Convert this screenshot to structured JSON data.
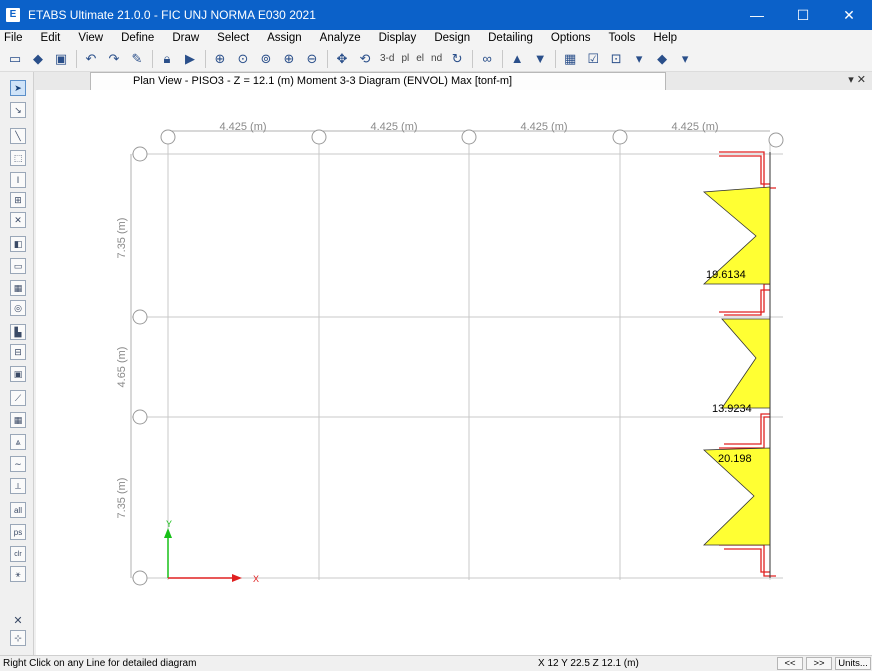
{
  "window": {
    "title": "ETABS Ultimate 21.0.0 - FIC UNJ NORMA E030 2021",
    "app_icon": "E",
    "minimize": "—",
    "maximize": "☐",
    "close": "✕"
  },
  "menu": [
    "File",
    "Edit",
    "View",
    "Define",
    "Draw",
    "Select",
    "Assign",
    "Analyze",
    "Display",
    "Design",
    "Detailing",
    "Options",
    "Tools",
    "Help"
  ],
  "toolbar": {
    "view_3d": "3-d",
    "plan": "pl",
    "elev": "el",
    "nd": "nd"
  },
  "doc_tab": {
    "title": "Plan View - PISO3 - Z = 12.1 (m)   Moment 3-3 Diagram   (ENVOL) Max  [tonf-m]",
    "controls": "▾ ✕"
  },
  "plan": {
    "x_spacings": [
      "4.425 (m)",
      "4.425 (m)",
      "4.425 (m)",
      "4.425 (m)"
    ],
    "y_spacings": [
      "7.35 (m)",
      "4.65 (m)",
      "7.35 (m)"
    ],
    "moment_values": [
      "19.6134",
      "13.9234",
      "20.198"
    ],
    "axis_x": "X",
    "axis_y": "Y",
    "diagram_color": "#ffff33",
    "frame_color": "#e02020"
  },
  "left_tools": {
    "all": "all",
    "ps": "ps",
    "clr": "clr",
    "close": "✕"
  },
  "status": {
    "hint": "Right Click on any Line for detailed diagram",
    "coords": "X 12  Y 22.5  Z 12.1 (m)",
    "prev": "<<",
    "next": ">>",
    "units": "Units..."
  }
}
